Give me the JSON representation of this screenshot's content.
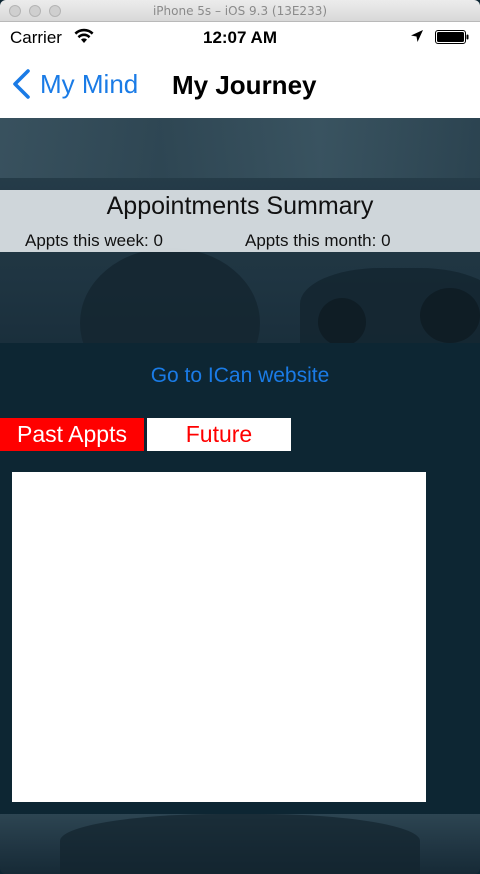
{
  "simulator": {
    "title": "iPhone 5s – iOS 9.3 (13E233)"
  },
  "status_bar": {
    "carrier": "Carrier",
    "time": "12:07 AM"
  },
  "nav": {
    "back_label": "My Mind",
    "title": "My Journey"
  },
  "summary": {
    "title": "Appointments Summary",
    "week_label": "Appts this week:  0",
    "month_label": "Appts this month:  0"
  },
  "link": {
    "label": "Go to ICan website"
  },
  "segments": {
    "past": "Past Appts",
    "future": "Future"
  },
  "colors": {
    "tint": "#1a7be6",
    "segment_active": "#ff0000",
    "background": "#0d2633"
  }
}
